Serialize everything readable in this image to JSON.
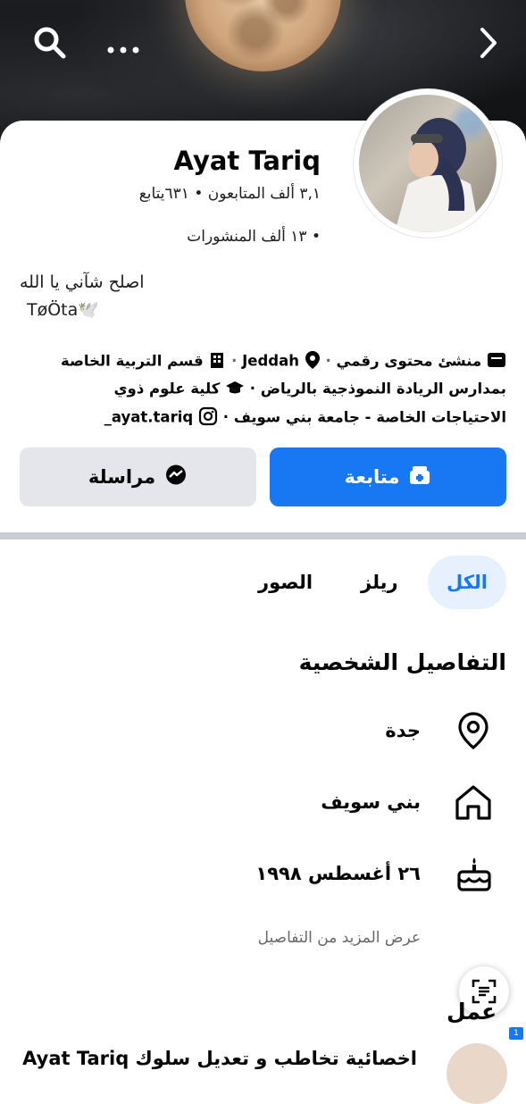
{
  "header": {
    "search_icon": "search-icon",
    "more_icon": "more-icon",
    "forward_icon": "chevron-right-icon"
  },
  "profile": {
    "name": "Ayat Tariq",
    "followers_following": "٣,١ ألف المتابعون • ٦٣١يتابع",
    "posts": "• ١٣ ألف المنشورات",
    "bio_line1": "اصلح شآني يا الله",
    "bio_line2": "TøÖta🕊️"
  },
  "info": {
    "line1": "منشئ محتوى رقمي · Jeddah · قسم التربية الخاصة",
    "line1_parts": [
      "منشئ محتوى رقمي",
      "Jeddah",
      "قسم التربية الخاصة"
    ],
    "line2": "بمدارس الريادة النموذجية بالرياض ·",
    "line2_edu": "كلية علوم ذوي",
    "line3": "الاحتياجات الخاصة - جامعة بني سويف ·",
    "instagram": "ayat.tariq_"
  },
  "actions": {
    "follow_label": "متابعة",
    "message_label": "مراسلة"
  },
  "tabs": [
    {
      "label": "الكل",
      "active": true
    },
    {
      "label": "ريلز",
      "active": false
    },
    {
      "label": "الصور",
      "active": false
    }
  ],
  "details": {
    "title": "التفاصيل الشخصية",
    "rows": [
      {
        "icon": "location-pin-icon",
        "text": "جدة"
      },
      {
        "icon": "home-icon",
        "text": "بني سويف"
      },
      {
        "icon": "birthday-cake-icon",
        "text": "٢٦ أغسطس ١٩٩٨"
      }
    ],
    "more_label": "عرض المزيد من التفاصيل"
  },
  "work": {
    "title": "عمل",
    "entry": "اخصائية تخاطب و تعديل سلوك Ayat Tariq"
  },
  "colors": {
    "accent": "#1877f2",
    "secondary_button": "#e4e6eb",
    "active_tab_bg": "#e7f1fd"
  }
}
